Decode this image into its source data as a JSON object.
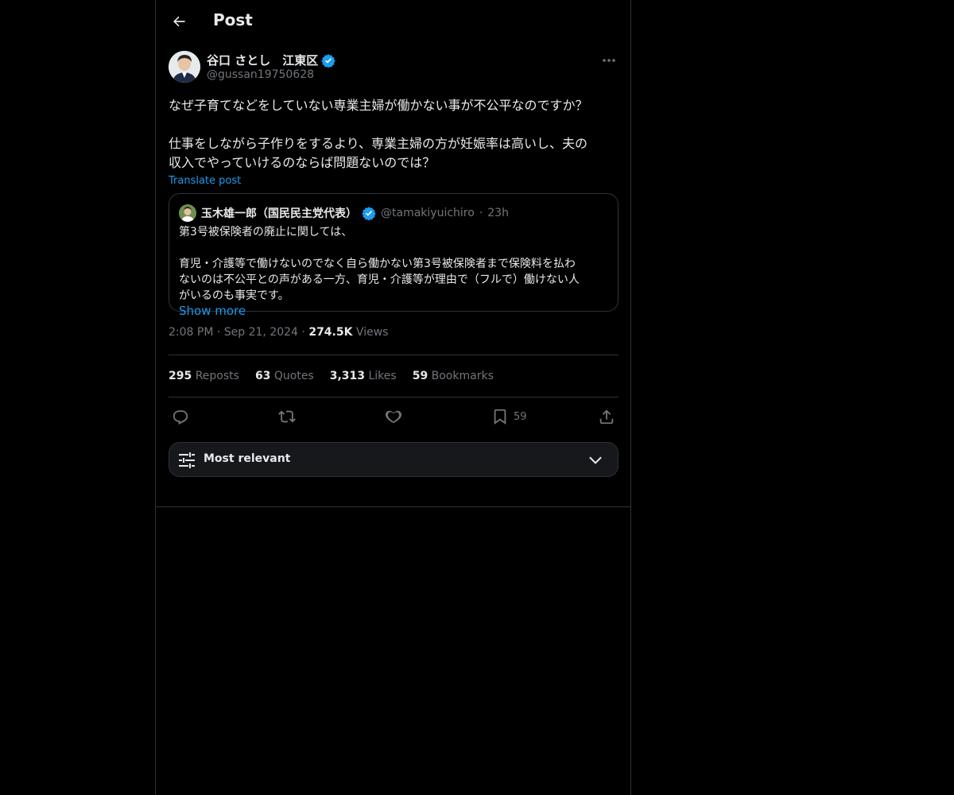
{
  "header": {
    "title": "Post"
  },
  "post": {
    "display_name": "谷口 さとし　江東区",
    "handle": "@gussan19750628",
    "text": "なぜ子育てなどをしていない専業主婦が働かない事が不公平なのですか？\n\n仕事をしながら子作りをするより、専業主婦の方が妊娠率は高いし、夫の\n収入でやっていけるのならば問題ないのでは？",
    "translate_label": "Translate post"
  },
  "quote": {
    "name": "玉木雄一郎（国民民主党代表）",
    "handle": "@tamakiyuichiro",
    "dot": "·",
    "time": "23h",
    "text": "第3号被保険者の廃止に関しては、\n\n育児・介護等で働けないのでなく自ら働かない第3号被保険者まで保険料を払わ\nないのは不公平との声がある一方、育児・介護等が理由で（フルで）働けない人\nがいるのも事実です。",
    "show_more": "Show more"
  },
  "meta": {
    "time": "2:08 PM",
    "sep1": "·",
    "date": "Sep 21, 2024",
    "sep2": "·",
    "views_count": "274.5K",
    "views_label": "Views"
  },
  "stats": [
    {
      "count": "295",
      "label": "Reposts"
    },
    {
      "count": "63",
      "label": "Quotes"
    },
    {
      "count": "3,313",
      "label": "Likes"
    },
    {
      "count": "59",
      "label": "Bookmarks"
    }
  ],
  "actions": {
    "bookmark_count": "59"
  },
  "sort": {
    "label": "Most relevant"
  },
  "colors": {
    "accent": "#1d9bf0",
    "background": "#000000",
    "border": "#2f3336",
    "muted": "#71767b"
  },
  "icons": [
    "back-arrow-icon",
    "verified-badge-icon",
    "more-icon",
    "reply-icon",
    "repost-icon",
    "like-icon",
    "bookmark-icon",
    "share-icon",
    "filter-icon",
    "chevron-down-icon"
  ]
}
